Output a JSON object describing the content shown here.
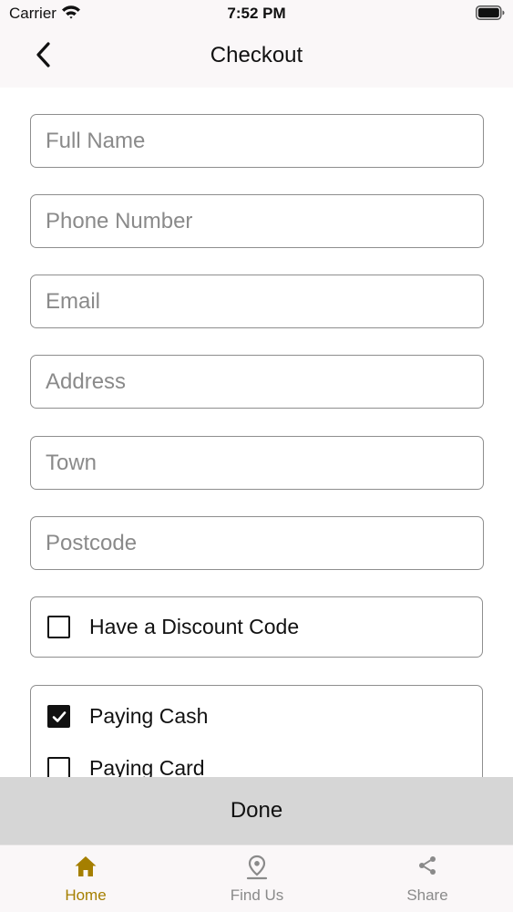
{
  "status_bar": {
    "carrier": "Carrier",
    "time": "7:52 PM"
  },
  "nav": {
    "title": "Checkout"
  },
  "form": {
    "fields": [
      {
        "placeholder": "Full Name",
        "value": ""
      },
      {
        "placeholder": "Phone Number",
        "value": ""
      },
      {
        "placeholder": "Email",
        "value": ""
      },
      {
        "placeholder": "Address",
        "value": ""
      },
      {
        "placeholder": "Town",
        "value": ""
      },
      {
        "placeholder": "Postcode",
        "value": ""
      }
    ],
    "discount": {
      "label": "Have a Discount Code",
      "checked": false
    },
    "payment": [
      {
        "label": "Paying Cash",
        "checked": true
      },
      {
        "label": "Paying Card",
        "checked": false
      }
    ]
  },
  "done_label": "Done",
  "tabs": [
    {
      "label": "Home",
      "icon": "home-icon",
      "active": true
    },
    {
      "label": "Find Us",
      "icon": "location-pin-icon",
      "active": false
    },
    {
      "label": "Share",
      "icon": "share-icon",
      "active": false
    }
  ],
  "colors": {
    "active_tab": "#a57f00",
    "inactive_tab": "#8a8a8a",
    "done_bar": "#d6d6d6",
    "header_bg": "#faf7f8"
  }
}
